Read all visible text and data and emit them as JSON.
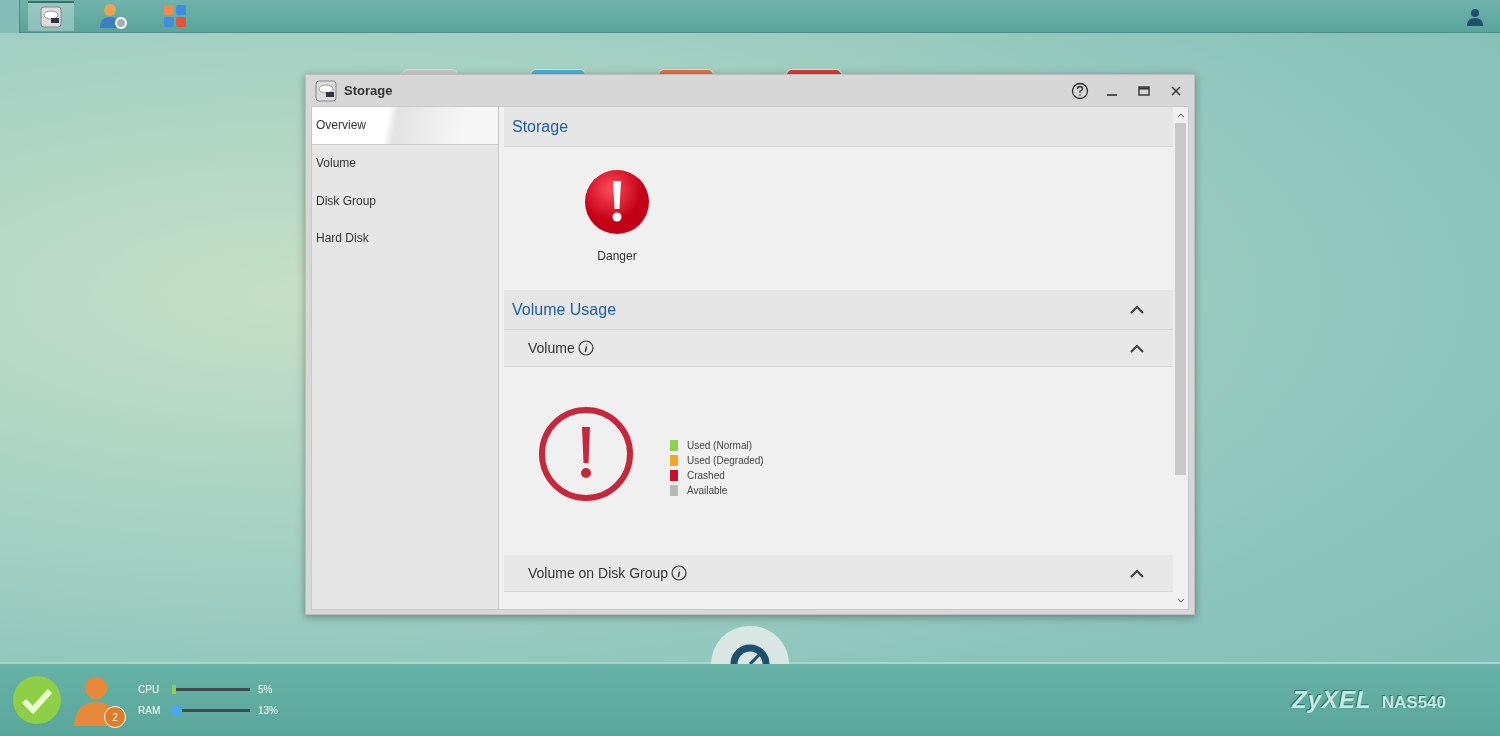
{
  "taskbar": {
    "apps": [
      {
        "kind": "storage",
        "selected": true
      },
      {
        "kind": "users",
        "selected": false
      },
      {
        "kind": "media",
        "selected": false
      }
    ]
  },
  "window": {
    "title": "Storage"
  },
  "sidebar": {
    "items": [
      {
        "label": "Overview",
        "selected": true
      },
      {
        "label": "Volume",
        "selected": false
      },
      {
        "label": "Disk Group",
        "selected": false
      },
      {
        "label": "Hard Disk",
        "selected": false
      }
    ]
  },
  "storage": {
    "heading": "Storage",
    "status": "Danger"
  },
  "volume_usage": {
    "heading": "Volume Usage",
    "expanded": true,
    "volume": {
      "heading": "Volume",
      "expanded": true,
      "legend": [
        {
          "label": "Used (Normal)",
          "color": "#8fd14f"
        },
        {
          "label": "Used (Degraded)",
          "color": "#f5a623"
        },
        {
          "label": "Crashed",
          "color": "#c8102e"
        },
        {
          "label": "Available",
          "color": "#b8b8b8"
        }
      ]
    },
    "disk_group": {
      "heading": "Volume on Disk Group",
      "expanded": true
    }
  },
  "status_bar": {
    "users_badge": "2",
    "meters": [
      {
        "label": "CPU",
        "level": 0.05,
        "reading": "5%",
        "color": "#8fd14f"
      },
      {
        "label": "RAM",
        "level": 0.13,
        "reading": "13%",
        "color": "#4aa8f0"
      }
    ],
    "brand": "ZyXEL",
    "model": "NAS540"
  }
}
